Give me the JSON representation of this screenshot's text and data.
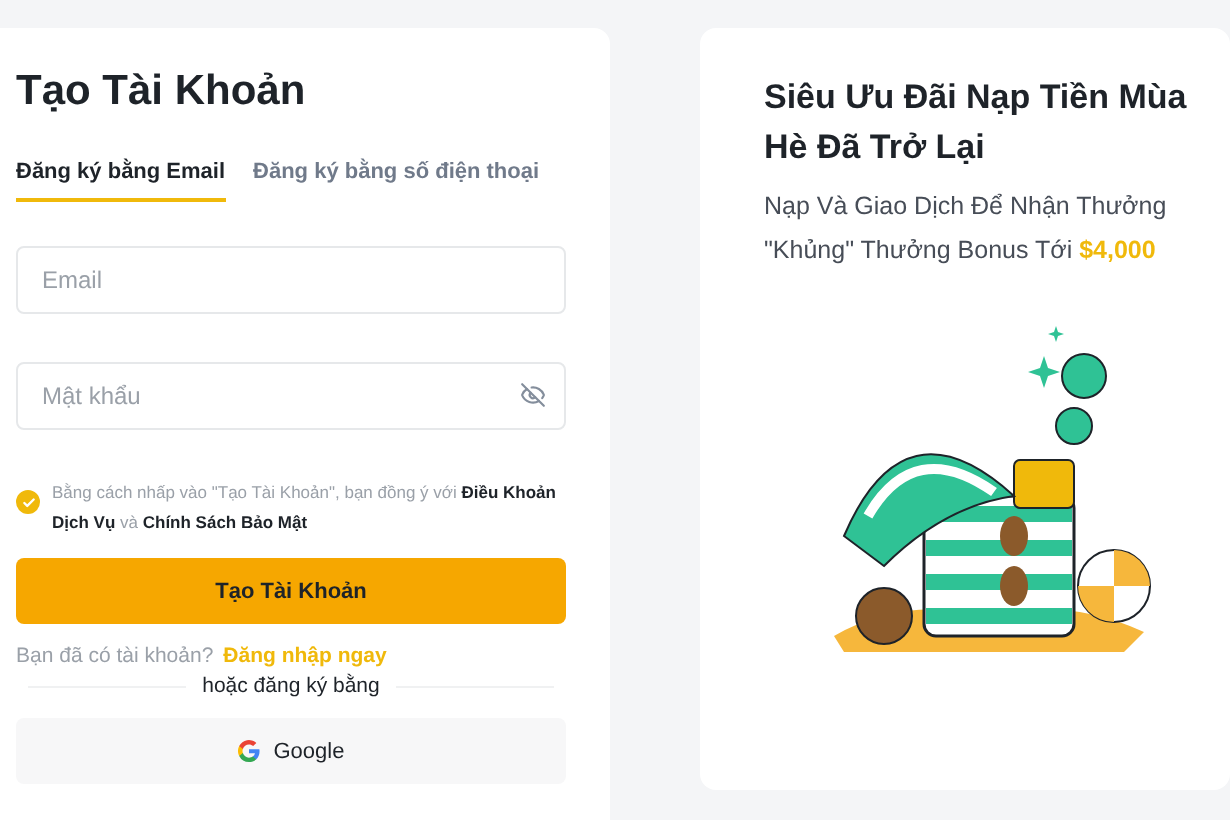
{
  "signup": {
    "title": "Tạo Tài Khoản",
    "tabs": [
      {
        "label": "Đăng ký bằng Email",
        "selected": true
      },
      {
        "label": "Đăng ký bằng số điện thoại",
        "selected": false
      }
    ],
    "fields": [
      {
        "placeholder": "Email",
        "kind": "text"
      },
      {
        "placeholder": "Mật khẩu",
        "kind": "password"
      }
    ],
    "agreement": {
      "checked": true,
      "text": "Bằng cách nhấp vào \"Tạo Tài Khoản\", bạn đồng ý với **Điều Khoản Dịch Vụ** và **Chính Sách Bảo Mật**"
    },
    "submit": "Tạo Tài Khoản",
    "login_prompt": "Bạn đã có tài khoản?",
    "login_link": "Đăng nhập ngay",
    "divider": "hoặc đăng ký bằng",
    "google_button": "Google"
  },
  "promo": {
    "title": "Siêu Ưu Đãi Nạp Tiền Mùa Hè Đã Trở Lại",
    "subtitle": "Nạp Và Giao Dịch Để Nhận Thưởng \"Khủng\" Thưởng Bonus Tới",
    "highlight": "$4,000"
  }
}
